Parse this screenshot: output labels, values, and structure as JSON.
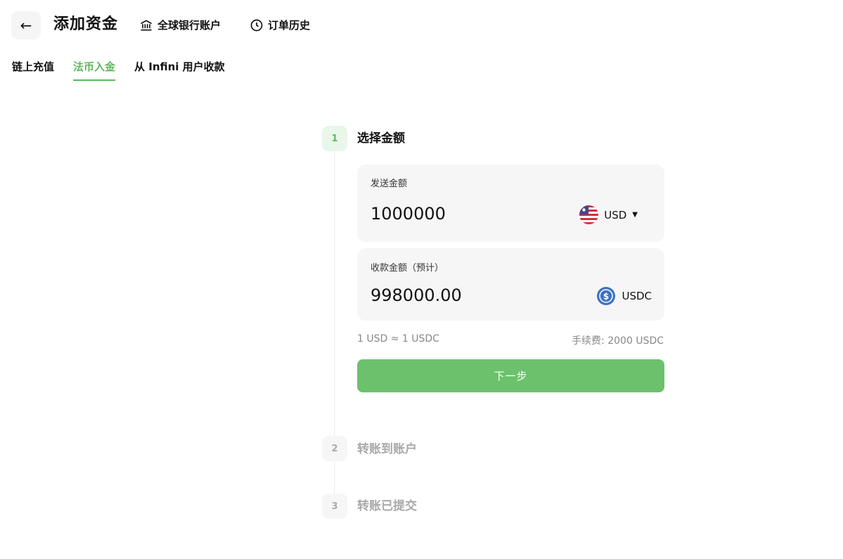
{
  "header": {
    "back_icon": "arrow-left-icon",
    "title": "添加资金",
    "bank_link": {
      "icon": "bank-icon",
      "label": "全球银行账户"
    },
    "history_link": {
      "icon": "clock-icon",
      "label": "订单历史"
    }
  },
  "tabs": [
    {
      "label": "链上充值",
      "active": false
    },
    {
      "label": "法币入金",
      "active": true
    },
    {
      "label": "从 Infini 用户收款",
      "active": false
    }
  ],
  "steps": [
    {
      "number": "1",
      "title": "选择金额",
      "active": true
    },
    {
      "number": "2",
      "title": "转账到账户",
      "active": false
    },
    {
      "number": "3",
      "title": "转账已提交",
      "active": false
    }
  ],
  "send": {
    "label": "发送金额",
    "amount": "1000000",
    "currency": "USD",
    "flag_icon": "us-flag-icon"
  },
  "receive": {
    "label": "收款金额（预计）",
    "amount": "998000.00",
    "currency": "USDC",
    "currency_icon": "usdc-icon"
  },
  "rate": "1 USD ≈ 1 USDC",
  "fee": "手续费: 2000 USDC",
  "next_label": "下一步",
  "colors": {
    "accent": "#5cb85c",
    "button": "#6cc16c",
    "card_bg": "#f6f6f6"
  }
}
